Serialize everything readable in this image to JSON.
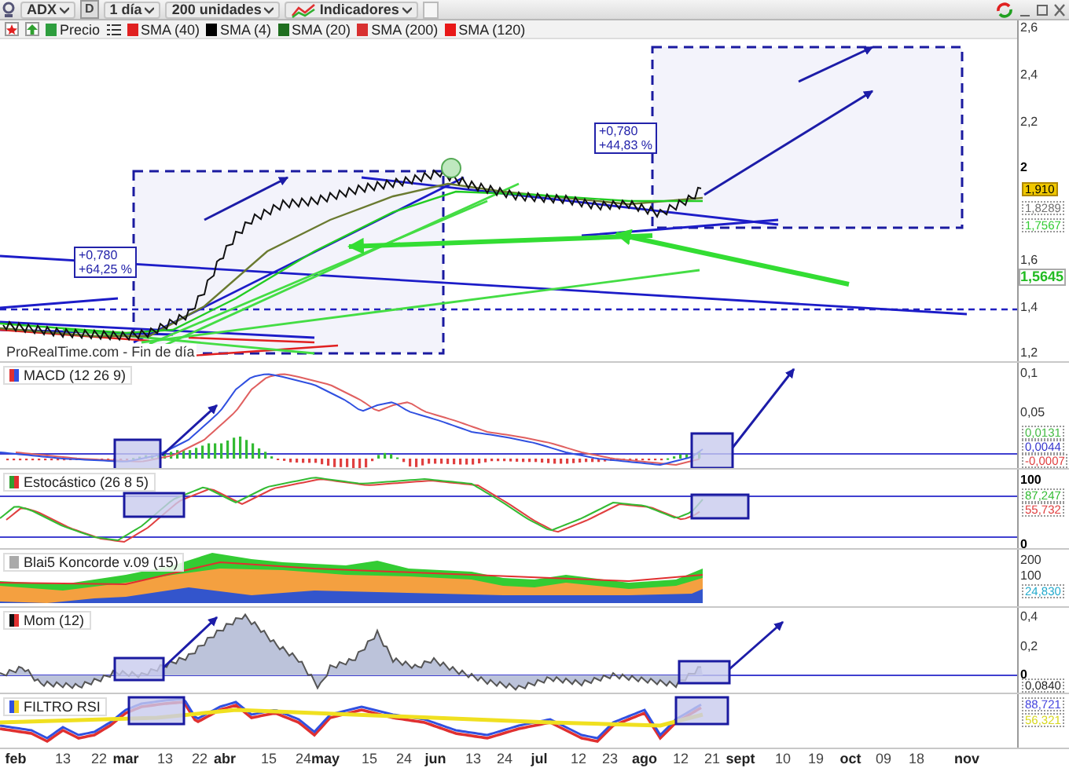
{
  "toolbar": {
    "symbol": "ADX",
    "period": "D",
    "timeframe": "1 día",
    "bars": "200 unidades",
    "indicators": "Indicadores"
  },
  "legend": [
    {
      "label": "Precio",
      "color": "#2e9e3e"
    },
    {
      "label": "SMA (40)",
      "color": "#e02020"
    },
    {
      "label": "SMA (4)",
      "color": "#000000"
    },
    {
      "label": "SMA (20)",
      "color": "#1f6e1f"
    },
    {
      "label": "SMA (200)",
      "color": "#d83030"
    },
    {
      "label": "SMA (120)",
      "color": "#e81818"
    }
  ],
  "chart": {
    "source": "ProRealTime.com - Fin de día",
    "annotations": [
      {
        "lines": [
          "+0,780",
          "+64,25 %"
        ]
      },
      {
        "lines": [
          "+0,780",
          "+44,83 %"
        ]
      }
    ],
    "y_ticks": [
      {
        "label": "2,6",
        "major": false
      },
      {
        "label": "2,4",
        "major": false
      },
      {
        "label": "2,2",
        "major": false
      },
      {
        "label": "2",
        "major": true
      },
      {
        "label": "1,6",
        "major": false
      },
      {
        "label": "1,4",
        "major": false
      },
      {
        "label": "1,2",
        "major": false
      }
    ],
    "value_labels": [
      {
        "text": "1,910",
        "kind": "highlight"
      },
      {
        "text": "1,8289",
        "kind": "boxed",
        "color": "#707070"
      },
      {
        "text": "1,7567",
        "kind": "boxed",
        "color": "#33cc33"
      },
      {
        "text": "1,5645",
        "kind": "emphasis",
        "color": "#22bb22"
      }
    ]
  },
  "panels": [
    {
      "kind": "macd",
      "title": "MACD (12 26 9)",
      "y_ticks": [
        {
          "label": "0,1",
          "major": false
        },
        {
          "label": "0,05",
          "major": false
        }
      ],
      "value_labels": [
        {
          "text": "0,0131",
          "kind": "boxed",
          "color": "#44bb44"
        },
        {
          "text": "0,0044",
          "kind": "boxed",
          "color": "#3333cc"
        },
        {
          "text": "-0,0007",
          "kind": "boxed",
          "color": "#e04040"
        }
      ]
    },
    {
      "kind": "stochastic",
      "title": "Estocástico (26 8 5)",
      "y_ticks": [
        {
          "label": "100",
          "major": true
        },
        {
          "label": "0",
          "major": true
        }
      ],
      "value_labels": [
        {
          "text": "87,247",
          "kind": "boxed",
          "color": "#33bb33"
        },
        {
          "text": "55,732",
          "kind": "boxed",
          "color": "#e04040"
        }
      ]
    },
    {
      "kind": "koncorde",
      "title": "Blai5 Koncorde v.09 (15)",
      "y_ticks": [
        {
          "label": "200",
          "major": false
        },
        {
          "label": "100",
          "major": false
        }
      ],
      "value_labels": [
        {
          "text": "24,830",
          "kind": "boxed",
          "color": "#22aacc"
        }
      ]
    },
    {
      "kind": "momentum",
      "title": "Mom (12)",
      "y_ticks": [
        {
          "label": "0,4",
          "major": false
        },
        {
          "label": "0,2",
          "major": false
        },
        {
          "label": "0",
          "major": true
        }
      ],
      "value_labels": [
        {
          "text": "0,0840",
          "kind": "boxed",
          "color": "#222222"
        }
      ]
    },
    {
      "kind": "rsi",
      "title": "FILTRO RSI",
      "value_labels": [
        {
          "text": "88,721",
          "kind": "boxed",
          "color": "#4444dd"
        },
        {
          "text": "56,321",
          "kind": "boxed",
          "color": "#d8d820"
        }
      ]
    }
  ],
  "x_axis": [
    {
      "label": "feb",
      "major": true
    },
    {
      "label": "13",
      "major": false
    },
    {
      "label": "22",
      "major": false
    },
    {
      "label": "mar",
      "major": true
    },
    {
      "label": "13",
      "major": false
    },
    {
      "label": "22",
      "major": false
    },
    {
      "label": "abr",
      "major": true
    },
    {
      "label": "15",
      "major": false
    },
    {
      "label": "24",
      "major": false
    },
    {
      "label": "may",
      "major": true
    },
    {
      "label": "15",
      "major": false
    },
    {
      "label": "24",
      "major": false
    },
    {
      "label": "jun",
      "major": true
    },
    {
      "label": "13",
      "major": false
    },
    {
      "label": "24",
      "major": false
    },
    {
      "label": "jul",
      "major": true
    },
    {
      "label": "12",
      "major": false
    },
    {
      "label": "23",
      "major": false
    },
    {
      "label": "ago",
      "major": true
    },
    {
      "label": "12",
      "major": false
    },
    {
      "label": "21",
      "major": false
    },
    {
      "label": "sept",
      "major": true
    },
    {
      "label": "10",
      "major": false
    },
    {
      "label": "19",
      "major": false
    },
    {
      "label": "oct",
      "major": true
    },
    {
      "label": "09",
      "major": false
    },
    {
      "label": "18",
      "major": false
    },
    {
      "label": "nov",
      "major": true
    }
  ]
}
